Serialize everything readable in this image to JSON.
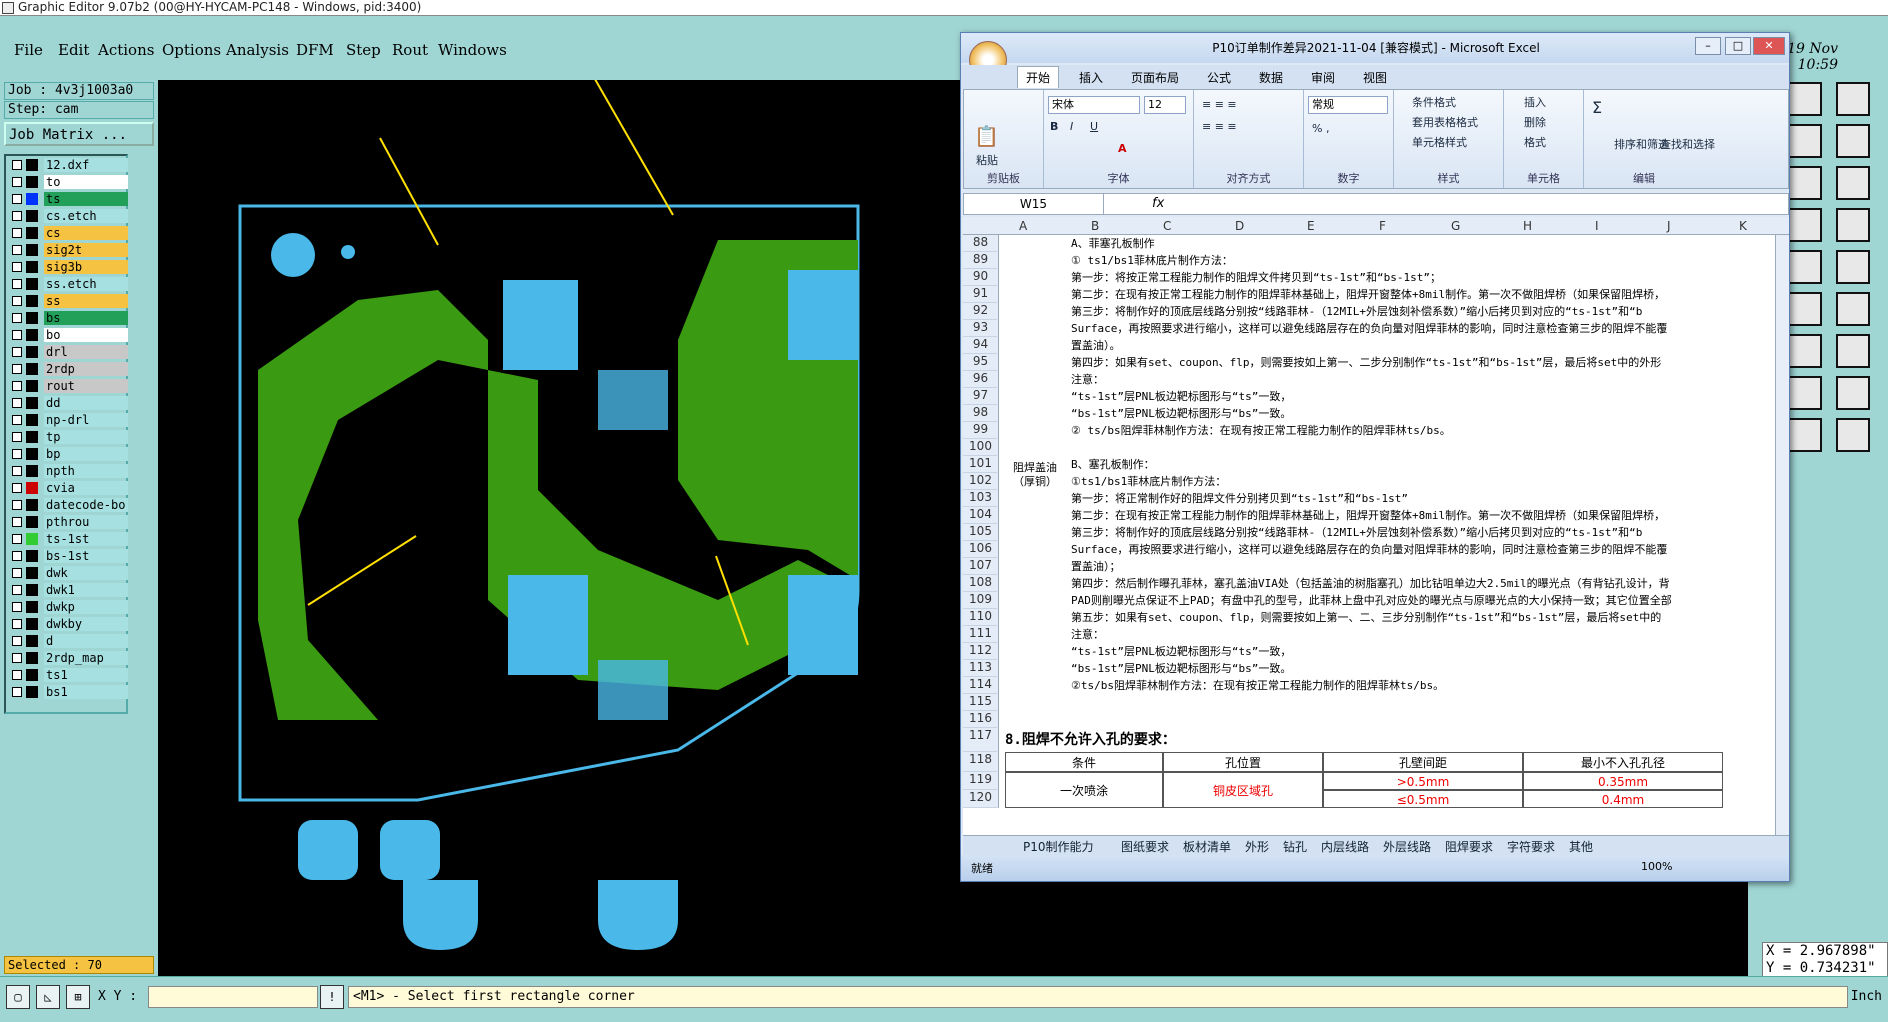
{
  "window": {
    "title": "Graphic Editor 9.07b2 (00@HY-HYCAM-PC148 - Windows, pid:3400)"
  },
  "menu": [
    "File",
    "Edit",
    "Actions",
    "Options",
    "Analysis",
    "DFM",
    "Step",
    "Rout",
    "Windows"
  ],
  "clock": {
    "date": "19 Nov",
    "time": "10:59"
  },
  "job": {
    "job_label": "Job : 4v3j1003a0",
    "step_label": "Step: cam",
    "matrix_button": "Job Matrix ..."
  },
  "layers": [
    {
      "name": "12.dxf",
      "color": "#a7e0e0"
    },
    {
      "name": "to",
      "color": "#ffffff"
    },
    {
      "name": "ts",
      "color": "#22a05a",
      "swatch": "#0033ff"
    },
    {
      "name": "cs.etch",
      "color": "#a7e0e0"
    },
    {
      "name": "cs",
      "color": "#f5c242"
    },
    {
      "name": "sig2t",
      "color": "#f5c242"
    },
    {
      "name": "sig3b",
      "color": "#f5c242"
    },
    {
      "name": "ss.etch",
      "color": "#a7e0e0"
    },
    {
      "name": "ss",
      "color": "#f5c242"
    },
    {
      "name": "bs",
      "color": "#22a05a"
    },
    {
      "name": "bo",
      "color": "#ffffff"
    },
    {
      "name": "drl",
      "color": "#c8c8c8"
    },
    {
      "name": "2rdp",
      "color": "#c8c8c8"
    },
    {
      "name": "rout",
      "color": "#c8c8c8"
    },
    {
      "name": "dd",
      "color": "#a7e0e0"
    },
    {
      "name": "np-drl",
      "color": "#a7e0e0"
    },
    {
      "name": "tp",
      "color": "#a7e0e0"
    },
    {
      "name": "bp",
      "color": "#a7e0e0"
    },
    {
      "name": "npth",
      "color": "#a7e0e0"
    },
    {
      "name": "cvia",
      "color": "#a7e0e0",
      "swatch": "#cc0000"
    },
    {
      "name": "datecode-bo",
      "color": "#a7e0e0"
    },
    {
      "name": "pthrou",
      "color": "#a7e0e0"
    },
    {
      "name": "ts-1st",
      "color": "#a7e0e0",
      "swatch": "#33cc33"
    },
    {
      "name": "bs-1st",
      "color": "#a7e0e0"
    },
    {
      "name": "dwk",
      "color": "#a7e0e0"
    },
    {
      "name": "dwk1",
      "color": "#a7e0e0"
    },
    {
      "name": "dwkp",
      "color": "#a7e0e0"
    },
    {
      "name": "dwkby",
      "color": "#a7e0e0"
    },
    {
      "name": "d",
      "color": "#a7e0e0"
    },
    {
      "name": "2rdp_map",
      "color": "#a7e0e0"
    },
    {
      "name": "ts1",
      "color": "#a7e0e0"
    },
    {
      "name": "bs1",
      "color": "#a7e0e0"
    }
  ],
  "selected": "Selected : 70",
  "coords": {
    "x": "X = 2.967898\"",
    "y": "Y = 0.734231\""
  },
  "status": {
    "xy_label": "X Y :",
    "prompt": "<M1> - Select first rectangle corner",
    "unit": "Inch"
  },
  "excel": {
    "title": "P10订单制作差异2021-11-04 [兼容模式] - Microsoft Excel",
    "tabs": [
      "开始",
      "插入",
      "页面布局",
      "公式",
      "数据",
      "审阅",
      "视图"
    ],
    "font_name": "宋体",
    "font_size": "12",
    "number_format": "常规",
    "groups": [
      "剪贴板",
      "字体",
      "对齐方式",
      "数字",
      "样式",
      "单元格",
      "编辑"
    ],
    "ribbon_buttons": {
      "paste": "粘贴",
      "cond_format": "条件格式",
      "table_format": "套用表格格式",
      "cell_style": "单元格样式",
      "insert": "插入",
      "delete": "删除",
      "format": "格式",
      "sort": "排序和筛选",
      "find": "查找和选择"
    },
    "name_box": "W15",
    "columns": [
      "A",
      "B",
      "C",
      "D",
      "E",
      "F",
      "G",
      "H",
      "I",
      "J",
      "K"
    ],
    "rows": [
      {
        "n": "88",
        "text": "A、菲塞孔板制作"
      },
      {
        "n": "89",
        "text": "① ts1/bs1菲林底片制作方法："
      },
      {
        "n": "90",
        "text": "第一步：将按正常工程能力制作的阻焊文件拷贝到“ts-1st”和“bs-1st”；"
      },
      {
        "n": "91",
        "text": "第二步：在现有按正常工程能力制作的阻焊菲林基础上，阻焊开窗整体+8mil制作。第一次不做阻焊桥（如果保留阻焊桥，"
      },
      {
        "n": "92",
        "text": "第三步：将制作好的顶底层线路分别按“线路菲林-（12MIL+外层蚀刻补偿系数）”缩小后拷贝到对应的“ts-1st”和“b"
      },
      {
        "n": "93",
        "text": "Surface，再按照要求进行缩小，这样可以避免线路层存在的负向量对阻焊菲林的影响，同时注意检查第三步的阻焊不能覆"
      },
      {
        "n": "94",
        "text": "置盖油）。"
      },
      {
        "n": "95",
        "text": "第四步：如果有set、coupon、flp，则需要按如上第一、二步分别制作“ts-1st”和“bs-1st”层，最后将set中的外形"
      },
      {
        "n": "96",
        "text": "注意："
      },
      {
        "n": "97",
        "text": "“ts-1st”层PNL板边靶标图形与“ts”一致，"
      },
      {
        "n": "98",
        "text": "“bs-1st”层PNL板边靶标图形与“bs”一致。"
      },
      {
        "n": "99",
        "text": "② ts/bs阻焊菲林制作方法：在现有按正常工程能力制作的阻焊菲林ts/bs。"
      },
      {
        "n": "100",
        "text": ""
      },
      {
        "n": "101",
        "text": "B、塞孔板制作："
      },
      {
        "n": "102",
        "text": "①ts1/bs1菲林底片制作方法："
      },
      {
        "n": "103",
        "text": "第一步：将正常制作好的阻焊文件分别拷贝到“ts-1st”和“bs-1st”"
      },
      {
        "n": "104",
        "text": "第二步：在现有按正常工程能力制作的阻焊菲林基础上，阻焊开窗整体+8mil制作。第一次不做阻焊桥（如果保留阻焊桥，"
      },
      {
        "n": "105",
        "text": "第三步：将制作好的顶底层线路分别按“线路菲林-（12MIL+外层蚀刻补偿系数）”缩小后拷贝到对应的“ts-1st”和“b"
      },
      {
        "n": "106",
        "text": "Surface，再按照要求进行缩小，这样可以避免线路层存在的负向量对阻焊菲林的影响，同时注意检查第三步的阻焊不能覆"
      },
      {
        "n": "107",
        "text": "置盖油）；"
      },
      {
        "n": "108",
        "text": "第四步：然后制作曝孔菲林，塞孔盖油VIA处（包括盖油的树脂塞孔）加比钻咀单边大2.5mil的曝光点（有背钻孔设计，背"
      },
      {
        "n": "109",
        "text": "PAD则削曝光点保证不上PAD；有盘中孔的型号，此菲林上盘中孔对应处的曝光点与原曝光点的大小保持一致；其它位置全部"
      },
      {
        "n": "110",
        "text": "第五步：如果有set、coupon、flp，则需要按如上第一、二、三步分别制作“ts-1st”和“bs-1st”层，最后将set中的"
      },
      {
        "n": "111",
        "text": "注意："
      },
      {
        "n": "112",
        "text": "“ts-1st”层PNL板边靶标图形与“ts”一致，"
      },
      {
        "n": "113",
        "text": "“bs-1st”层PNL板边靶标图形与“bs”一致。"
      },
      {
        "n": "114",
        "text": "②ts/bs阻焊菲林制作方法：在现有按正常工程能力制作的阻焊菲林ts/bs。"
      },
      {
        "n": "115",
        "text": ""
      },
      {
        "n": "116",
        "text": ""
      }
    ],
    "side_labels": {
      "b_label_1": "阻焊盖油",
      "b_label_2": "（厚铜）"
    },
    "section8": {
      "n": "117",
      "title": "8.阻焊不允许入孔的要求："
    },
    "table": {
      "header_row_n": "118",
      "headers": [
        "条件",
        "孔位置",
        "孔壁间距",
        "最小不入孔孔径"
      ],
      "row_n": [
        "119",
        "120"
      ],
      "condition": "一次喷涂",
      "position": "铜皮区域孔",
      "gap": [
        ">0.5mm",
        "≤0.5mm"
      ],
      "min_dia": [
        "0.35mm",
        "0.4mm"
      ]
    },
    "sheets": [
      "P10制作能力",
      "图纸要求",
      "板材清单",
      "外形",
      "钻孔",
      "内层线路",
      "外层线路",
      "阻焊要求",
      "字符要求",
      "其他"
    ],
    "status_ready": "就绪",
    "zoom": "100%"
  }
}
